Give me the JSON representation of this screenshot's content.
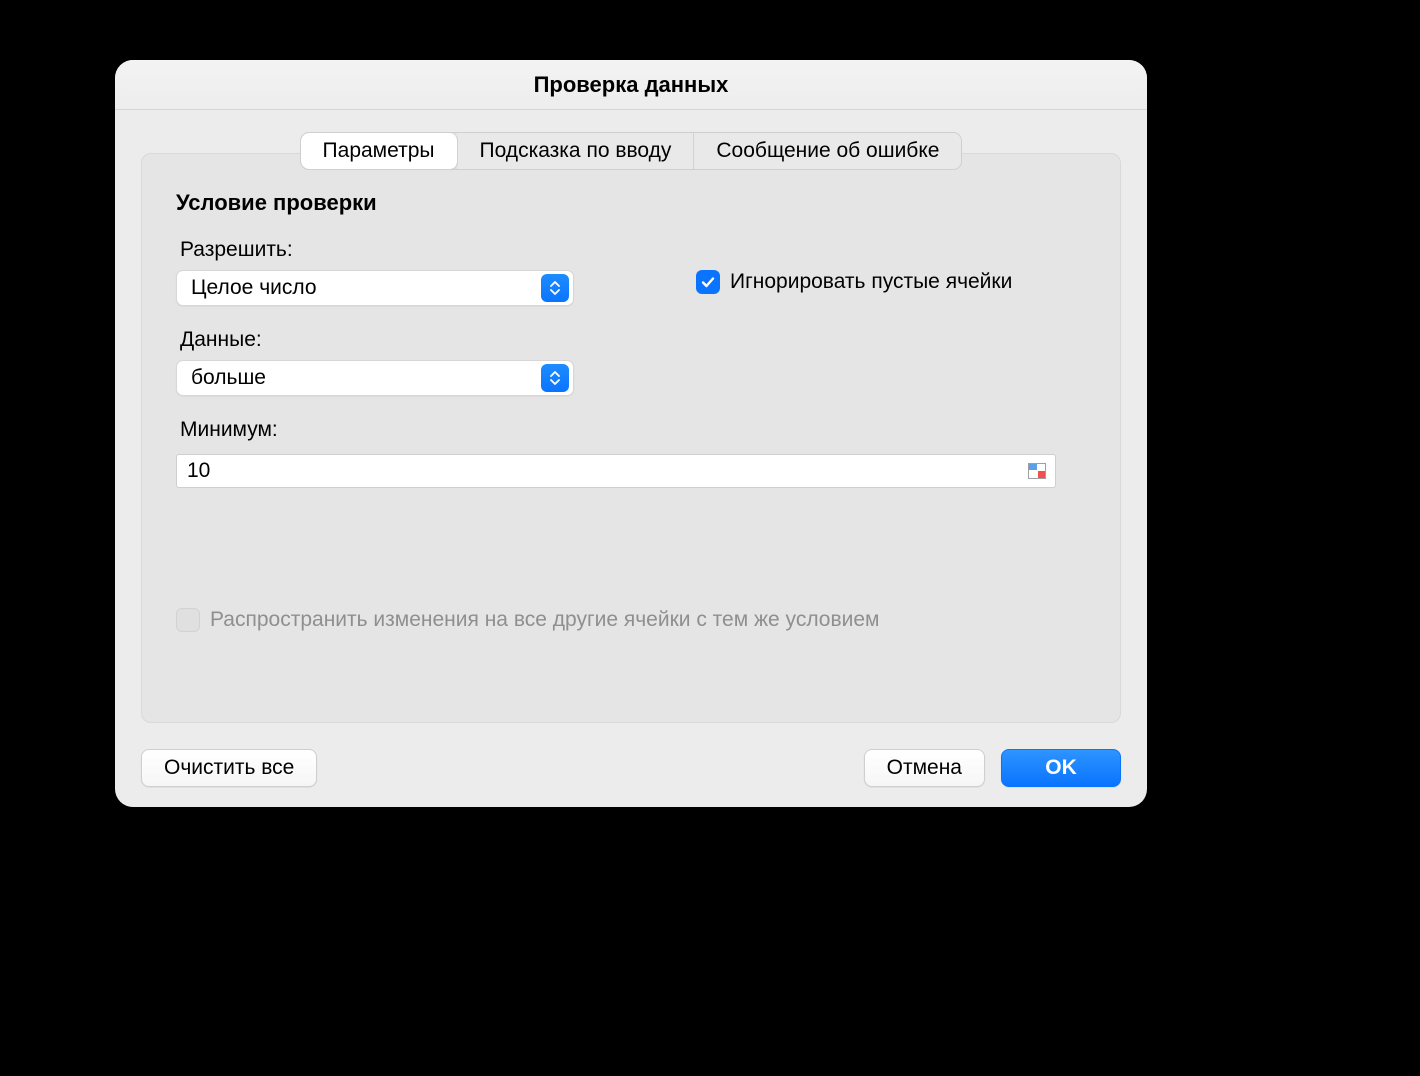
{
  "dialog": {
    "title": "Проверка данных"
  },
  "tabs": {
    "settings": "Параметры",
    "input_hint": "Подсказка по вводу",
    "error_msg": "Сообщение об ошибке"
  },
  "section": {
    "title": "Условие проверки"
  },
  "allow": {
    "label": "Разрешить:",
    "value": "Целое число"
  },
  "data_cond": {
    "label": "Данные:",
    "value": "больше"
  },
  "minimum": {
    "label": "Минимум:",
    "value": "10"
  },
  "ignore_empty": {
    "label": "Игнорировать пустые ячейки"
  },
  "propagate": {
    "label": "Распространить изменения на все другие ячейки с тем же условием"
  },
  "buttons": {
    "clear_all": "Очистить все",
    "cancel": "Отмена",
    "ok": "OK"
  }
}
